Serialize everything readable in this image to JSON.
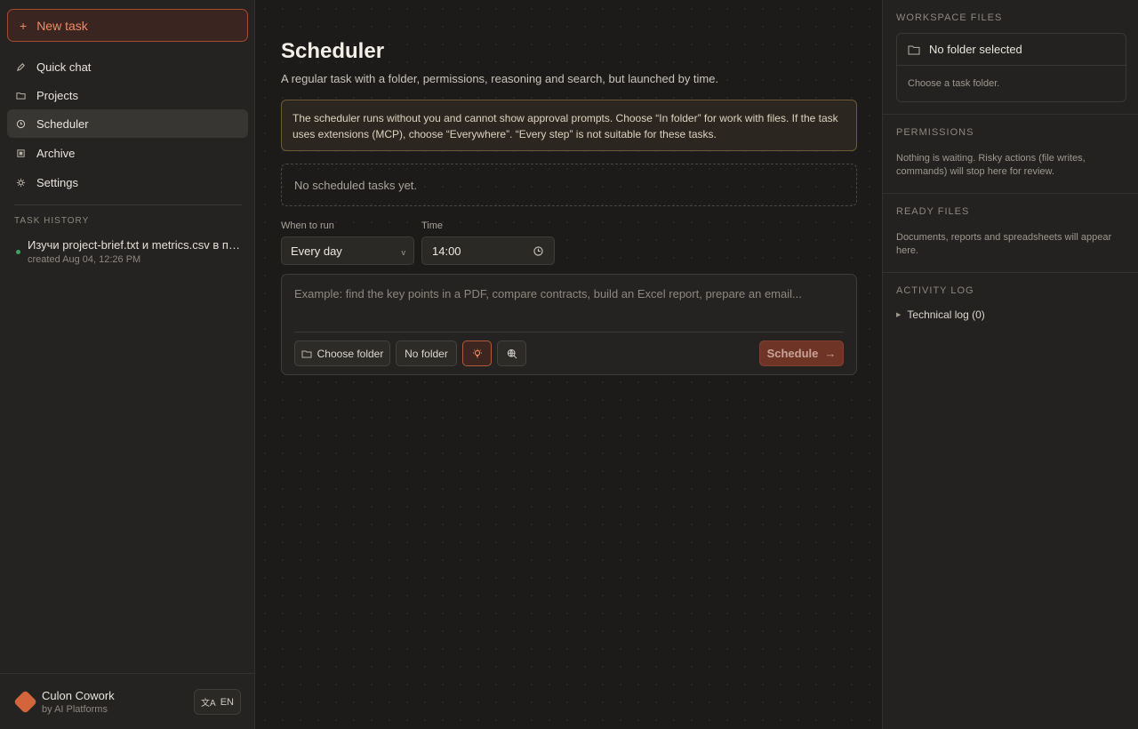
{
  "sidebar": {
    "new_task_label": "New task",
    "nav": [
      {
        "label": "Quick chat",
        "icon": "pencil-icon"
      },
      {
        "label": "Projects",
        "icon": "folder-icon"
      },
      {
        "label": "Scheduler",
        "icon": "clock-icon",
        "active": true
      },
      {
        "label": "Archive",
        "icon": "archive-icon"
      },
      {
        "label": "Settings",
        "icon": "gear-icon"
      }
    ],
    "history_label": "TASK HISTORY",
    "history": [
      {
        "title": "Изучи project-brief.txt и metrics.csv в проекте и подготовь отчёт",
        "created": "created Aug 04, 12:26 PM",
        "status_color": "#3fa35d"
      }
    ],
    "brand_name": "Culon Cowork",
    "brand_sub": "by AI Platforms",
    "lang": "EN"
  },
  "main": {
    "title": "Scheduler",
    "description": "A regular task with a folder, permissions, reasoning and search, but launched by time.",
    "notice": "The scheduler runs without you and cannot show approval prompts. Choose “In folder” for work with files. If the task uses extensions (MCP), choose “Everywhere”. “Every step” is not suitable for these tasks.",
    "empty_text": "No scheduled tasks yet.",
    "when_label": "When to run",
    "when_value": "Every day",
    "time_label": "Time",
    "time_value": "14:00",
    "prompt_placeholder": "Example: find the key points in a PDF, compare contracts, build an Excel report, prepare an email...",
    "choose_folder_label": "Choose folder",
    "no_folder_label": "No folder",
    "schedule_label": "Schedule"
  },
  "right": {
    "workspace_label": "WORKSPACE FILES",
    "no_folder_selected": "No folder selected",
    "choose_task_folder": "Choose a task folder.",
    "permissions_label": "PERMISSIONS",
    "permissions_text": "Nothing is waiting. Risky actions (file writes, commands) will stop here for review.",
    "ready_label": "READY FILES",
    "ready_text": "Documents, reports and spreadsheets will appear here.",
    "activity_label": "ACTIVITY LOG",
    "technical_log": "Technical log (0)"
  },
  "colors": {
    "accent": "#d2653c",
    "background": "#1c1b19",
    "panel": "#242321"
  }
}
